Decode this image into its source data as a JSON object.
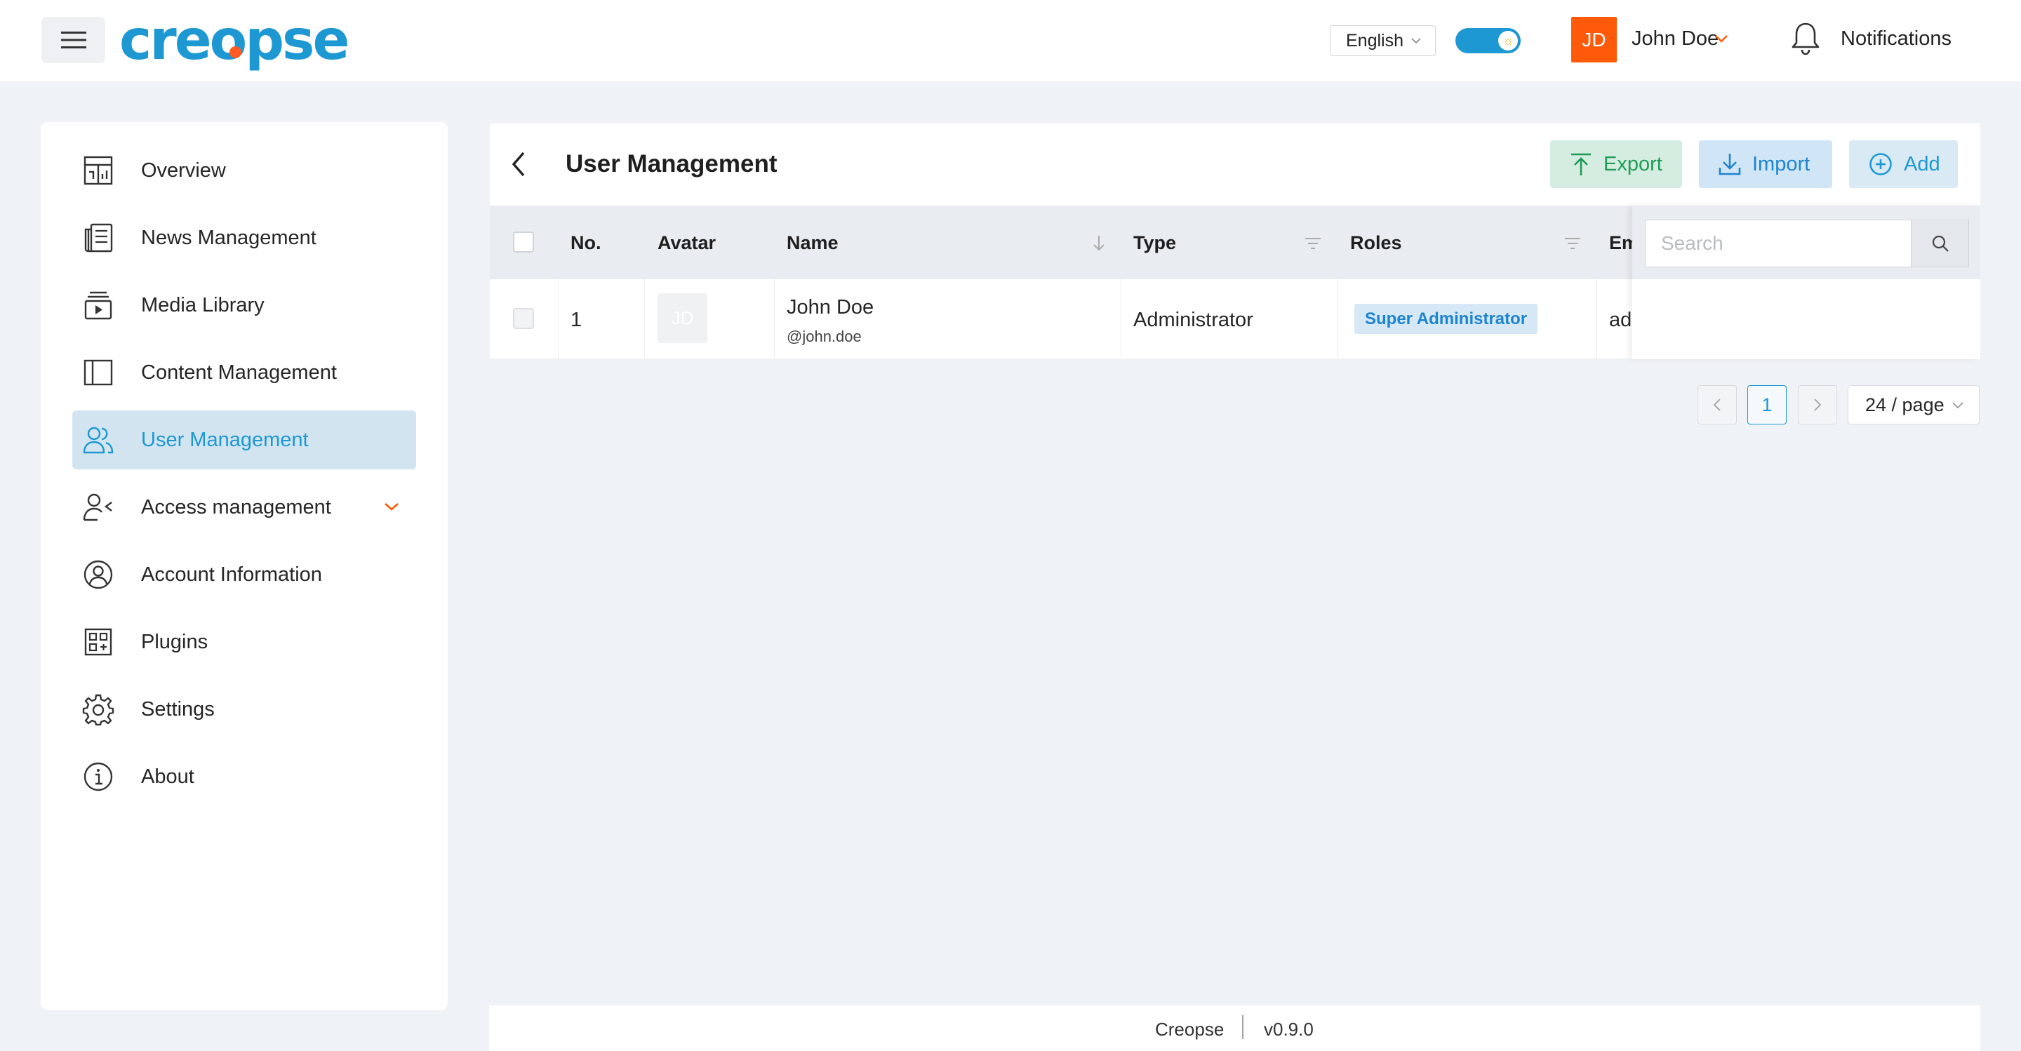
{
  "app": {
    "logo_text": "creopse"
  },
  "header": {
    "language": "English",
    "user_initials": "JD",
    "user_name": "John Doe",
    "notifications_label": "Notifications"
  },
  "sidebar": {
    "items": [
      {
        "label": "Overview",
        "icon": "dashboard-icon"
      },
      {
        "label": "News Management",
        "icon": "newspaper-icon"
      },
      {
        "label": "Media Library",
        "icon": "media-library-icon"
      },
      {
        "label": "Content Management",
        "icon": "layout-icon"
      },
      {
        "label": "User Management",
        "icon": "users-icon",
        "active": true
      },
      {
        "label": "Access management",
        "icon": "user-access-icon",
        "expandable": true
      },
      {
        "label": "Account Information",
        "icon": "user-circle-icon"
      },
      {
        "label": "Plugins",
        "icon": "plugins-icon"
      },
      {
        "label": "Settings",
        "icon": "gear-icon"
      },
      {
        "label": "About",
        "icon": "info-icon"
      }
    ]
  },
  "main": {
    "title": "User Management",
    "buttons": {
      "export": "Export",
      "import": "Import",
      "add": "Add"
    },
    "table": {
      "columns": [
        "No.",
        "Avatar",
        "Name",
        "Type",
        "Roles",
        "Em"
      ],
      "rows": [
        {
          "no": "1",
          "avatar_initials": "JD",
          "name": "John Doe",
          "handle": "@john.doe",
          "type": "Administrator",
          "role": "Super Administrator",
          "email_partial": "ad"
        }
      ]
    },
    "search_placeholder": "Search",
    "pagination": {
      "current_page": "1",
      "page_size": "24 / page"
    }
  },
  "footer": {
    "brand": "Creopse",
    "version": "v0.9.0"
  },
  "colors": {
    "accent": "#1d98d3",
    "orange": "#ff5a0a",
    "export_green": "#1e9b55"
  }
}
